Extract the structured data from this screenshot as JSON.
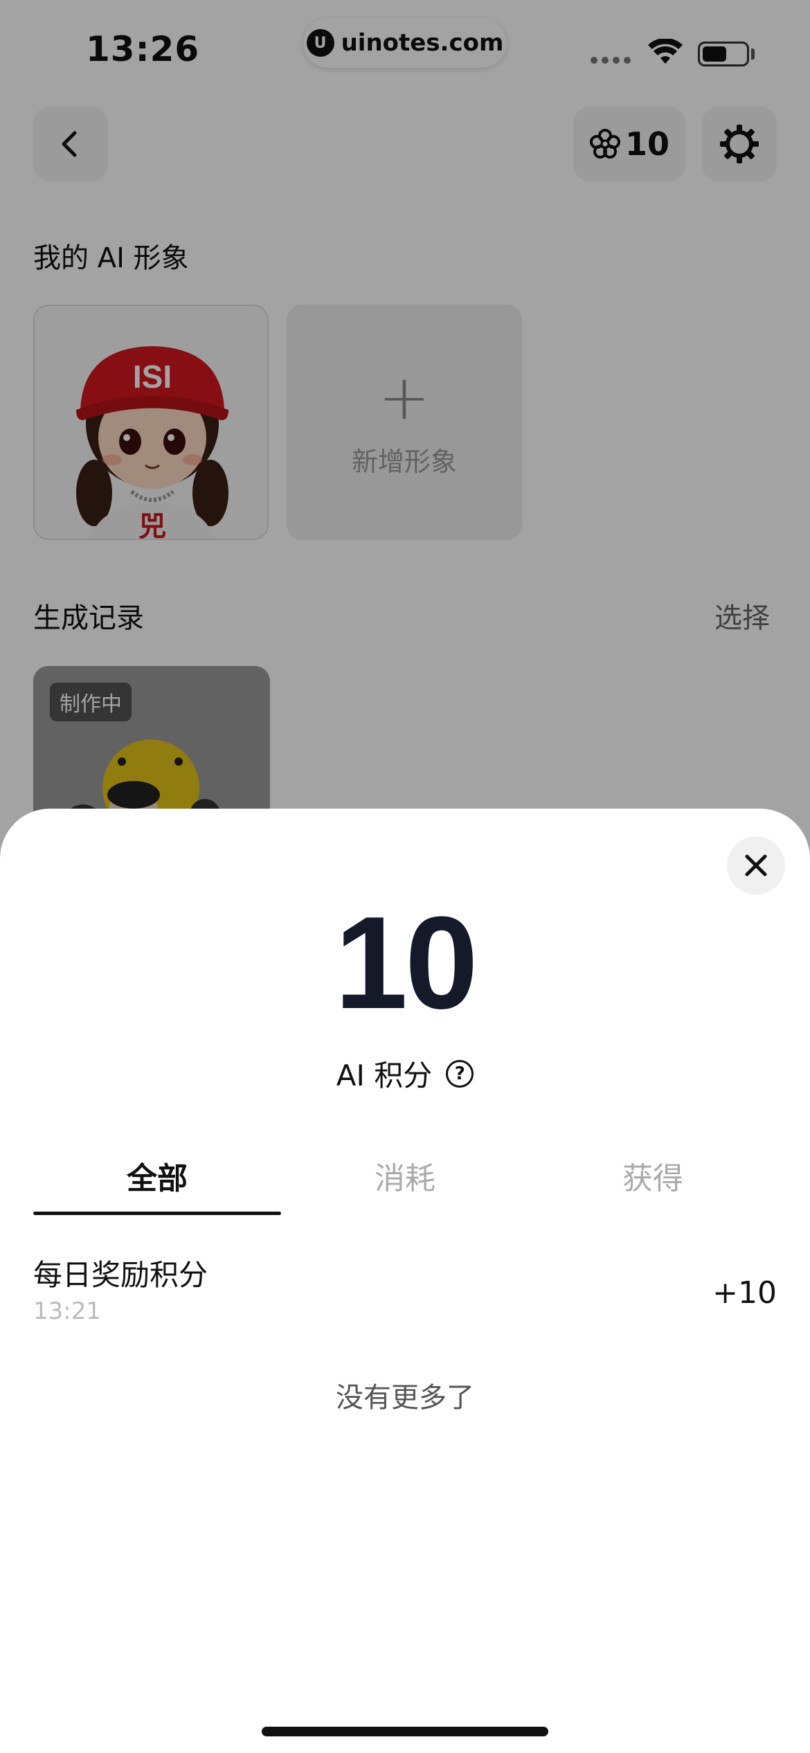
{
  "status_bar": {
    "time": "13:26",
    "url": "uinotes.com"
  },
  "header": {
    "points": "10"
  },
  "sections": {
    "my_ai_title": "我的 AI 形象",
    "add_avatar_label": "新增形象",
    "history_title": "生成记录",
    "select_label": "选择",
    "making_badge": "制作中"
  },
  "sheet": {
    "points_value": "10",
    "points_label": "AI 积分",
    "tabs": [
      {
        "label": "全部"
      },
      {
        "label": "消耗"
      },
      {
        "label": "获得"
      }
    ],
    "records": [
      {
        "name": "每日奖励积分",
        "time": "13:21",
        "amount": "+10"
      }
    ],
    "no_more": "没有更多了"
  },
  "colors": {
    "sheet_bg": "#ffffff",
    "number_color": "#151a2b",
    "tab_inactive": "#aaaaaa",
    "dim_overlay": "rgba(0,0,0,0.36)"
  }
}
